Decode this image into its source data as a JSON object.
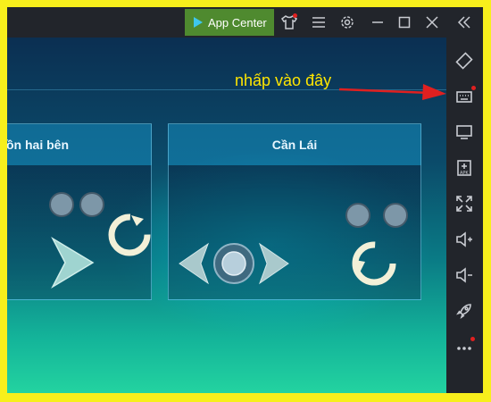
{
  "titlebar": {
    "app_center_label": "App Center",
    "icons": [
      "tshirt-icon",
      "menu-icon",
      "gear-icon",
      "minimize-icon",
      "maximize-icon",
      "close-icon",
      "collapse-sidebar-icon"
    ]
  },
  "annotation": {
    "text": "nhấp vào đây",
    "color": "#ffe600"
  },
  "panels": [
    {
      "title": "ồn hai bên"
    },
    {
      "title": "Cần Lái"
    }
  ],
  "sidebar": {
    "icons": [
      "rotate-icon",
      "keyboard-icon",
      "screen-icon",
      "apk-install-icon",
      "fullscreen-icon",
      "volume-up-icon",
      "volume-down-icon",
      "rocket-icon",
      "more-icon"
    ]
  },
  "colors": {
    "frame": "#f7ef1c",
    "app_center_bg": "#4f8a2f",
    "notification_dot": "#e02020",
    "arrow": "#e02020"
  }
}
